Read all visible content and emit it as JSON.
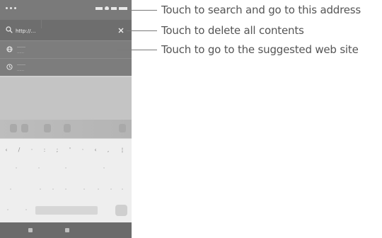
{
  "browser": {
    "url_input": "http://…",
    "suggestions": [
      {
        "title": "……",
        "url": "……"
      },
      {
        "title": "……",
        "url": "……"
      }
    ]
  },
  "callouts": {
    "search": "Touch to search and go to this address",
    "delete": "Touch to delete all contents",
    "suggested": "Touch to go to the suggested web site"
  },
  "icons": {
    "search": "search-icon",
    "clear": "clear-icon",
    "suggestion": "globe-icon",
    "history": "history-icon"
  }
}
